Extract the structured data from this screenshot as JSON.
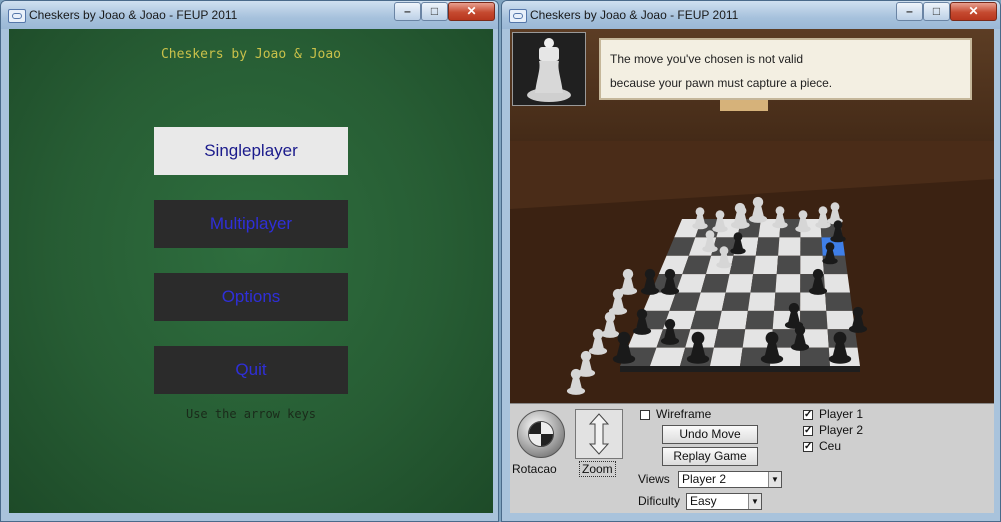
{
  "left_window": {
    "title": "Cheskers by Joao & Joao - FEUP 2011",
    "controls": {
      "minimize": "–",
      "maximize": "□",
      "close": "✕"
    },
    "menu": {
      "title": "Cheskers by Joao & Joao",
      "buttons": [
        {
          "label": "Singleplayer",
          "selected": true
        },
        {
          "label": "Multiplayer",
          "selected": false
        },
        {
          "label": "Options",
          "selected": false
        },
        {
          "label": "Quit",
          "selected": false
        }
      ],
      "hint": "Use the arrow keys"
    }
  },
  "right_window": {
    "title": "Cheskers by Joao & Joao - FEUP 2011",
    "controls": {
      "minimize": "–",
      "maximize": "□",
      "close": "✕"
    },
    "message": {
      "line1": "The move you've chosen is not valid",
      "line2": "because your pawn must capture a piece."
    },
    "panel": {
      "rotation_label": "Rotacao",
      "zoom_label": "Zoom",
      "wireframe": {
        "label": "Wireframe",
        "checked": false
      },
      "undo_label": "Undo Move",
      "replay_label": "Replay Game",
      "views": {
        "label": "Views",
        "value": "Player 2"
      },
      "difficulty": {
        "label": "Dificulty",
        "value": "Easy"
      },
      "toggles": [
        {
          "label": "Player 1",
          "checked": true
        },
        {
          "label": "Player 2",
          "checked": true
        },
        {
          "label": "Ceu",
          "checked": true
        }
      ]
    }
  },
  "colors": {
    "felt_green": "#275d34",
    "menu_text": "#2f2fd8",
    "title_yellow": "#c9c14a",
    "selected_square": "#3f7fe8"
  },
  "icons": {
    "window_icon": "app-window-icon",
    "rotation": "rotation-wheel-icon",
    "zoom": "zoom-arrow-icon",
    "avatar": "chess-queen-avatar-icon"
  }
}
